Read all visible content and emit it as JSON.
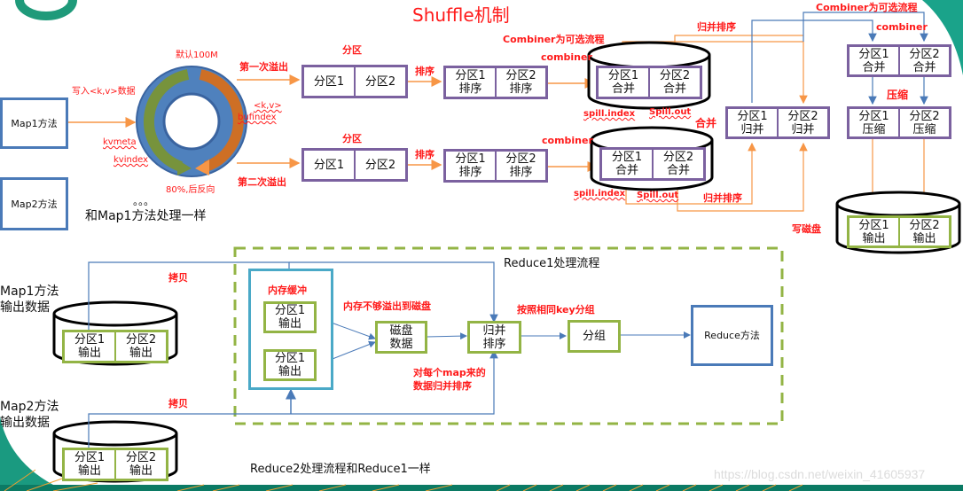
{
  "title": "Shuffle机制",
  "map_side": {
    "map1_label": "Map1方法",
    "map2_label": "Map2方法",
    "map2_note": "。。。",
    "map2_caption": "和Map1方法处理一样",
    "write_label": "写入<k,v>数据",
    "buffer": {
      "default_size": "默认100M",
      "kv_label": "<k,v>",
      "bufindex": "bufindex",
      "kvmeta": "kvmeta",
      "kvindex": "kvindex",
      "threshold": "80%,后反向"
    },
    "spill1_label": "第一次溢出",
    "spill2_label": "第二次溢出",
    "partition_label": "分区",
    "sort_label": "排序",
    "partitions": [
      "分区1",
      "分区2"
    ],
    "sorted": [
      "分区1\n排序",
      "分区2\n排序"
    ],
    "combiner_optional": "Combiner为可选流程",
    "combiner": "combiner",
    "combined": [
      "分区1\n合并",
      "分区2\n合并"
    ],
    "spill_index": "spill.index",
    "spill_out": "Spill.out",
    "merge_label": "合并",
    "merge_sort_label": "归并排序",
    "merged": [
      "分区1\n归并",
      "分区2\n归并"
    ],
    "compress_label": "压缩",
    "compressed": [
      "分区1\n压缩",
      "分区2\n压缩"
    ],
    "write_disk_label": "写磁盘",
    "outputs": [
      "分区1\n输出",
      "分区2\n输出"
    ]
  },
  "reduce_side": {
    "map1_output_label": "Map1方法\n输出数据",
    "map2_output_label": "Map2方法\n输出数据",
    "copy_label": "拷贝",
    "reduce1_title": "Reduce1处理流程",
    "memory_buffer_label": "内存缓冲",
    "buffer_items": [
      "分区1\n输出",
      "分区1\n输出"
    ],
    "spill_to_disk_label": "内存不够溢出到磁盘",
    "disk_data": "磁盘\n数据",
    "merge_sort": "归并\n排序",
    "merge_note": "对每个map来的\n数据归并排序",
    "group_by_key_label": "按照相同key分组",
    "group": "分组",
    "reduce_method": "Reduce方法",
    "reduce2_caption": "Reduce2处理流程和Reduce1一样"
  },
  "watermark": "https://blog.csdn.net/weixin_41605937",
  "colors": {
    "accent_red": "#ff1a1a",
    "purple": "#7b619f",
    "green": "#93b445",
    "blue": "#4a7ab8",
    "orange": "#f79646",
    "teal": "#4aa9c7"
  }
}
